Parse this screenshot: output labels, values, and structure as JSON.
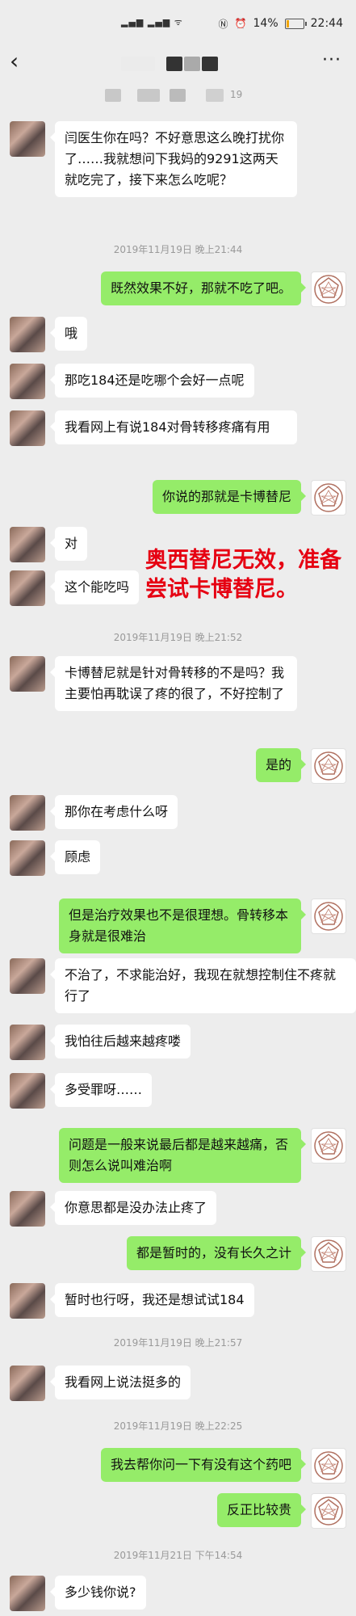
{
  "status": {
    "battery": "14%",
    "time": "22:44"
  },
  "header": {
    "back_icon": "‹",
    "more_icon": "···",
    "subtitle_tail": "19"
  },
  "timestamps": [
    "2019年11月19日 晚上21:44",
    "2019年11月19日 晚上21:52",
    "2019年11月19日 晚上21:57",
    "2019年11月19日 晚上22:25",
    "2019年11月21日 下午14:54"
  ],
  "messages": [
    {
      "side": "left",
      "text": "闫医生你在吗？不好意思这么晚打扰你了……我就想问下我妈的9291这两天就吃完了，接下来怎么吃呢？"
    },
    {
      "side": "right",
      "text": "既然效果不好，那就不吃了吧。"
    },
    {
      "side": "left",
      "text": "哦"
    },
    {
      "side": "left",
      "text": "那吃184还是吃哪个会好一点呢"
    },
    {
      "side": "left",
      "text": "我看网上有说184对骨转移疼痛有用"
    },
    {
      "side": "right",
      "text": "你说的那就是卡博替尼"
    },
    {
      "side": "left",
      "text": "对"
    },
    {
      "side": "left",
      "text": "这个能吃吗"
    },
    {
      "side": "left",
      "text": "卡博替尼就是针对骨转移的不是吗？我主要怕再耽误了疼的很了，不好控制了"
    },
    {
      "side": "right",
      "text": "是的"
    },
    {
      "side": "left",
      "text": "那你在考虑什么呀"
    },
    {
      "side": "left",
      "text": "顾虑"
    },
    {
      "side": "right",
      "text": "但是治疗效果也不是很理想。骨转移本身就是很难治"
    },
    {
      "side": "left",
      "text": "不治了，不求能治好，我现在就想控制住不疼就行了"
    },
    {
      "side": "left",
      "text": "我怕往后越来越疼喽"
    },
    {
      "side": "left",
      "text": "多受罪呀……"
    },
    {
      "side": "right",
      "text": "问题是一般来说最后都是越来越痛，否则怎么说叫难治啊"
    },
    {
      "side": "left",
      "text": "你意思都是没办法止疼了"
    },
    {
      "side": "right",
      "text": "都是暂时的，没有长久之计"
    },
    {
      "side": "left",
      "text": "暂时也行呀，我还是想试试184"
    },
    {
      "side": "left",
      "text": "我看网上说法挺多的"
    },
    {
      "side": "right",
      "text": "我去帮你问一下有没有这个药吧"
    },
    {
      "side": "right",
      "text": "反正比较贵"
    },
    {
      "side": "left",
      "text": "多少钱你说?"
    }
  ],
  "annotation": "奥西替尼无效，准备尝试卡博替尼。",
  "colors": {
    "bg": "#ededed",
    "self_bubble": "#95ec69",
    "other_bubble": "#ffffff",
    "annotation": "#e60012"
  }
}
